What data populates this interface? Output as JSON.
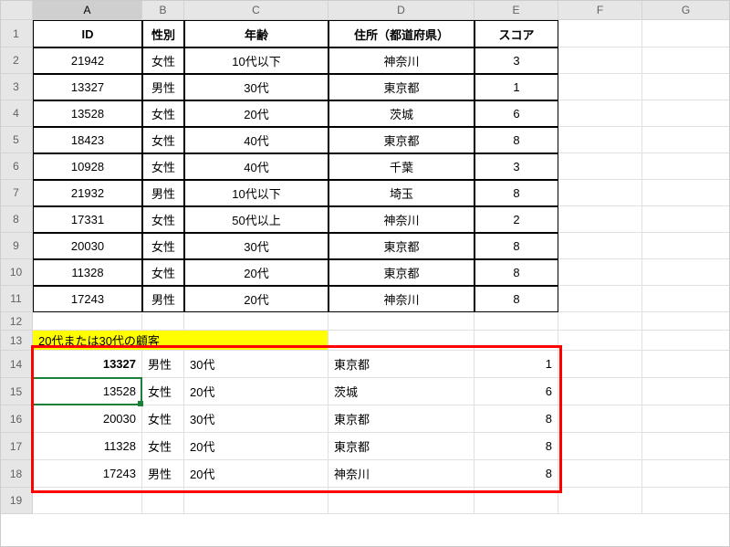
{
  "columns": [
    "A",
    "B",
    "C",
    "D",
    "E",
    "F",
    "G"
  ],
  "header": [
    "ID",
    "性別",
    "年齢",
    "住所（都道府県）",
    "スコア"
  ],
  "data_rows": [
    {
      "id": "21942",
      "sex": "女性",
      "age": "10代以下",
      "pref": "神奈川",
      "score": "3"
    },
    {
      "id": "13327",
      "sex": "男性",
      "age": "30代",
      "pref": "東京都",
      "score": "1"
    },
    {
      "id": "13528",
      "sex": "女性",
      "age": "20代",
      "pref": "茨城",
      "score": "6"
    },
    {
      "id": "18423",
      "sex": "女性",
      "age": "40代",
      "pref": "東京都",
      "score": "8"
    },
    {
      "id": "10928",
      "sex": "女性",
      "age": "40代",
      "pref": "千葉",
      "score": "3"
    },
    {
      "id": "21932",
      "sex": "男性",
      "age": "10代以下",
      "pref": "埼玉",
      "score": "8"
    },
    {
      "id": "17331",
      "sex": "女性",
      "age": "50代以上",
      "pref": "神奈川",
      "score": "2"
    },
    {
      "id": "20030",
      "sex": "女性",
      "age": "30代",
      "pref": "東京都",
      "score": "8"
    },
    {
      "id": "11328",
      "sex": "女性",
      "age": "20代",
      "pref": "東京都",
      "score": "8"
    },
    {
      "id": "17243",
      "sex": "男性",
      "age": "20代",
      "pref": "神奈川",
      "score": "8"
    }
  ],
  "filter_title": "20代または30代の顧客",
  "filter_rows": [
    {
      "id": "13327",
      "sex": "男性",
      "age": "30代",
      "pref": "東京都",
      "score": "1"
    },
    {
      "id": "13528",
      "sex": "女性",
      "age": "20代",
      "pref": "茨城",
      "score": "6"
    },
    {
      "id": "20030",
      "sex": "女性",
      "age": "30代",
      "pref": "東京都",
      "score": "8"
    },
    {
      "id": "11328",
      "sex": "女性",
      "age": "20代",
      "pref": "東京都",
      "score": "8"
    },
    {
      "id": "17243",
      "sex": "男性",
      "age": "20代",
      "pref": "神奈川",
      "score": "8"
    }
  ],
  "active_cell": {
    "col": "A",
    "row": 15
  },
  "row_numbers": [
    "1",
    "2",
    "3",
    "4",
    "5",
    "6",
    "7",
    "8",
    "9",
    "10",
    "11",
    "12",
    "13",
    "14",
    "15",
    "16",
    "17",
    "18",
    "19"
  ]
}
